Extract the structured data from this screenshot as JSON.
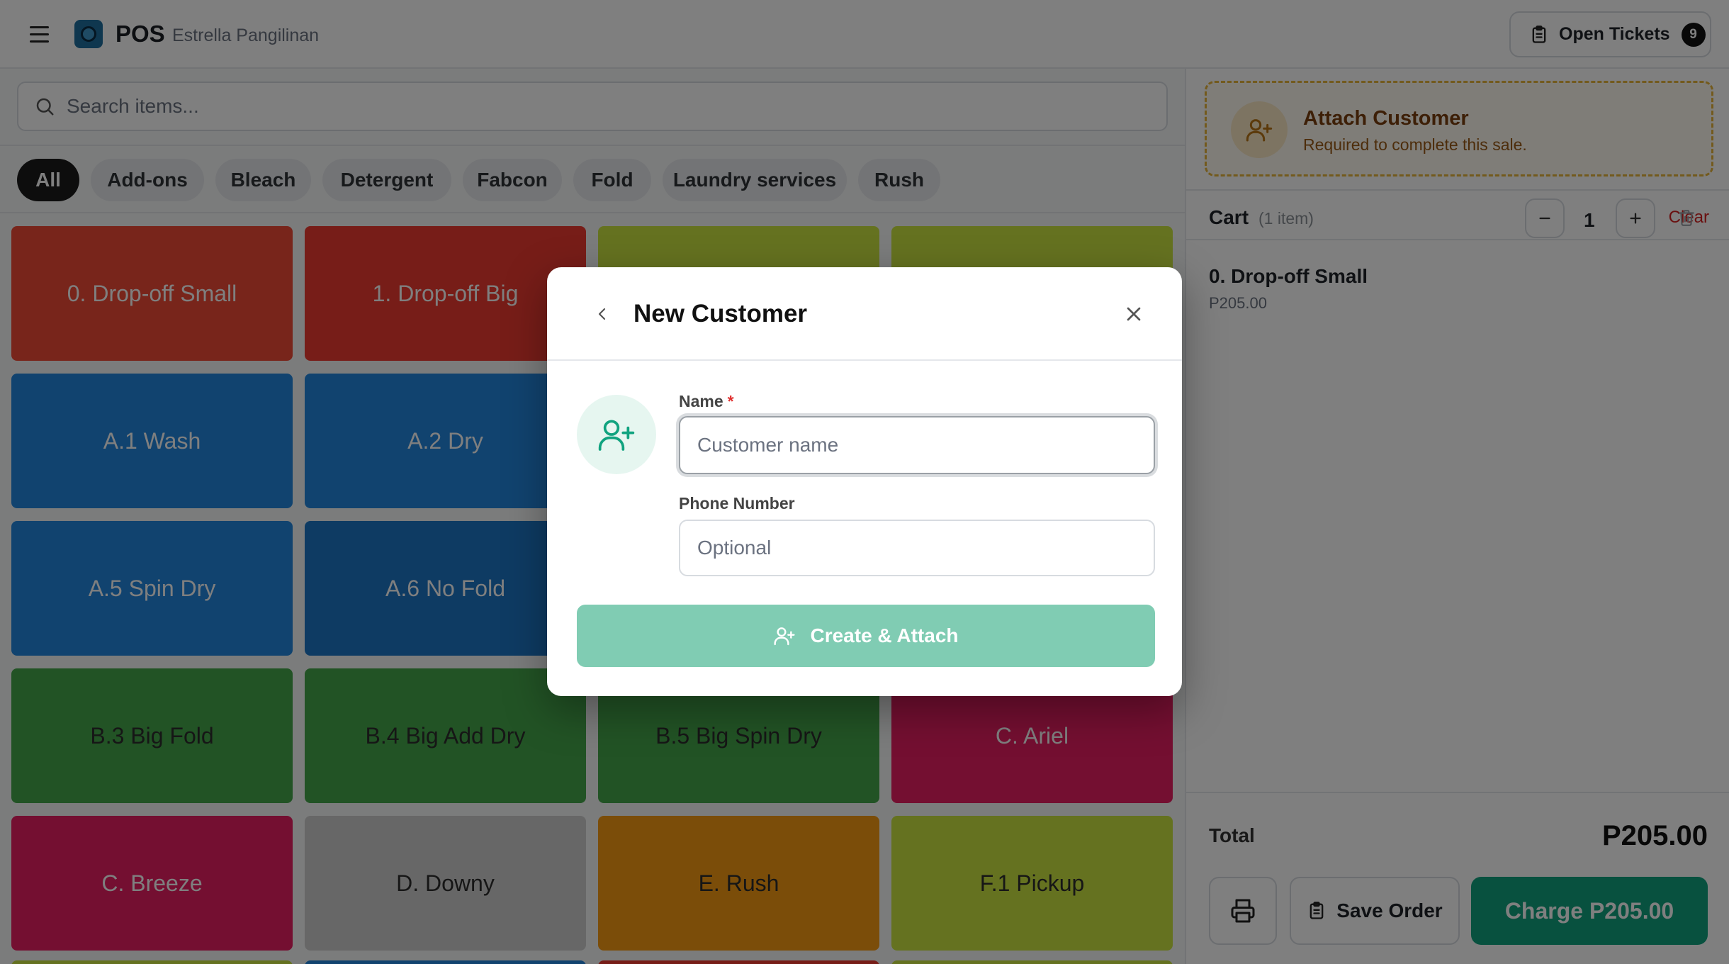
{
  "header": {
    "app_title": "POS",
    "user_name": "Estrella Pangilinan",
    "open_tickets_label": "Open Tickets",
    "open_tickets_count": "9"
  },
  "search": {
    "placeholder": "Search items..."
  },
  "categories": [
    "All",
    "Add-ons",
    "Bleach",
    "Detergent",
    "Fabcon",
    "Fold",
    "Laundry services",
    "Rush"
  ],
  "active_category": "All",
  "items": [
    {
      "label": "0. Drop-off Small",
      "color": "#f04a37"
    },
    {
      "label": "1. Drop-off Big",
      "color": "#ee3a30"
    },
    {
      "label": "",
      "color": "#cbe541"
    },
    {
      "label": "",
      "color": "#cbe541"
    },
    {
      "label": "A.1 Wash",
      "color": "#2287de"
    },
    {
      "label": "A.2 Dry",
      "color": "#2287de"
    },
    {
      "label": "",
      "color": "#2287de"
    },
    {
      "label": "",
      "color": "#2287de"
    },
    {
      "label": "A.5 Spin Dry",
      "color": "#2287de"
    },
    {
      "label": "A.6 No Fold",
      "color": "#1d77c6"
    },
    {
      "label": "",
      "color": "#2287de"
    },
    {
      "label": "",
      "color": "#2287de"
    },
    {
      "label": "B.3 Big Fold",
      "color": "#44a64a"
    },
    {
      "label": "B.4 Big Add Dry",
      "color": "#44a64a"
    },
    {
      "label": "B.5 Big Spin Dry",
      "color": "#44a64a"
    },
    {
      "label": "C. Ariel",
      "color": "#e91e63"
    },
    {
      "label": "C. Breeze",
      "color": "#e91e63"
    },
    {
      "label": "D. Downy",
      "color": "#cfcfcf"
    },
    {
      "label": "E. Rush",
      "color": "#f79a12"
    },
    {
      "label": "F.1 Pickup",
      "color": "#cbe541"
    }
  ],
  "attach_customer": {
    "title": "Attach Customer",
    "subtitle": "Required to complete this sale."
  },
  "cart": {
    "title": "Cart",
    "count_label": "(1 item)",
    "clear_label": "Clear",
    "items": [
      {
        "name": "0. Drop-off Small",
        "price": "P205.00",
        "qty": "1"
      }
    ],
    "total_label": "Total",
    "total_value": "P205.00",
    "save_label": "Save Order",
    "charge_label": "Charge P205.00"
  },
  "modal": {
    "title": "New Customer",
    "name_label": "Name",
    "name_required_mark": "*",
    "name_placeholder": "Customer name",
    "phone_label": "Phone Number",
    "phone_placeholder": "Optional",
    "submit_label": "Create & Attach"
  },
  "colors": {
    "accent_green": "#10a37f",
    "warning_border": "#e6b43a",
    "danger": "#d42020"
  }
}
